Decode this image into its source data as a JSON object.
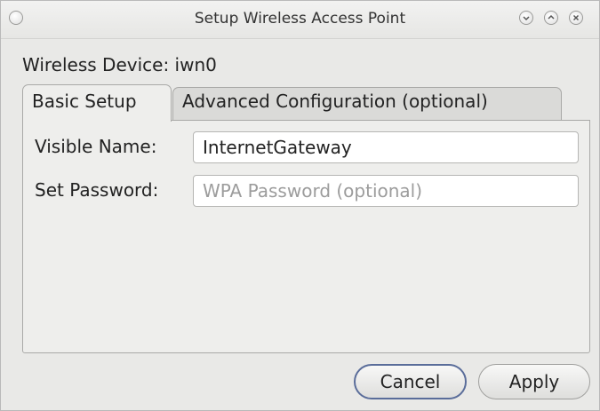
{
  "window": {
    "title": "Setup Wireless Access Point"
  },
  "device": {
    "label": "Wireless Device: iwn0"
  },
  "tabs": [
    {
      "label": "Basic Setup",
      "active": true
    },
    {
      "label": "Advanced Configuration (optional)",
      "active": false
    }
  ],
  "form": {
    "name_label": "Visible Name:",
    "name_value": "InternetGateway",
    "password_label": "Set Password:",
    "password_value": "",
    "password_placeholder": "WPA Password (optional)"
  },
  "buttons": {
    "cancel": "Cancel",
    "apply": "Apply"
  },
  "icons": {
    "menu": "window-menu-icon",
    "minimize": "minimize-icon",
    "maximize": "maximize-icon",
    "close": "close-icon"
  },
  "colors": {
    "focus_ring": "#5a6d9a",
    "background": "#e9e9e7"
  }
}
